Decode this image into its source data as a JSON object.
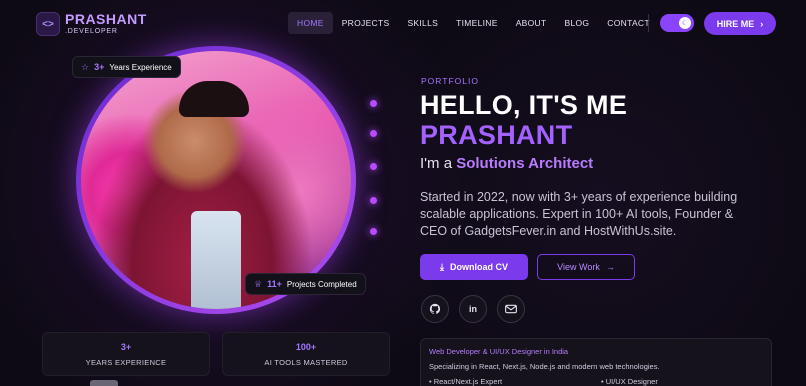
{
  "brand": {
    "icon": "<>",
    "title": "PRASHANT",
    "subtitle": ".DEVELOPER"
  },
  "nav": {
    "items": [
      "HOME",
      "PROJECTS",
      "SKILLS",
      "TIMELINE",
      "ABOUT",
      "BLOG",
      "CONTACT"
    ],
    "active": "HOME",
    "hire_label": "HIRE ME",
    "theme_toggle": "on"
  },
  "photo": {
    "badge_experience": {
      "value": "3+",
      "label": "Years Experience"
    },
    "badge_projects": {
      "value": "11+",
      "label": "Projects Completed"
    }
  },
  "stats": [
    {
      "value": "3+",
      "label": "YEARS EXPERIENCE"
    },
    {
      "value": "100+",
      "label": "AI TOOLS MASTERED"
    }
  ],
  "hero": {
    "eyebrow": "PORTFOLIO",
    "greeting": "HELLO, IT'S ME",
    "name": "PRASHANT",
    "role_prefix": "I'm a",
    "role": "Solutions Architect",
    "description": "Started in 2022, now with 3+ years of experience building scalable applications. Expert in 100+ AI tools, Founder & CEO of GadgetsFever.in and HostWithUs.site.",
    "primary_button": "Download CV",
    "secondary_button": "View Work"
  },
  "info_card": {
    "title": "Web Developer & UI/UX Designer in India",
    "text": "Specializing in React, Next.js, Node.js and modern web technologies.",
    "items": [
      "• React/Next.js Expert",
      "• UI/UX Designer"
    ]
  },
  "colors": {
    "accent": "#7c3aed",
    "accent_light": "#a477ff",
    "background": "#0d0a13"
  }
}
